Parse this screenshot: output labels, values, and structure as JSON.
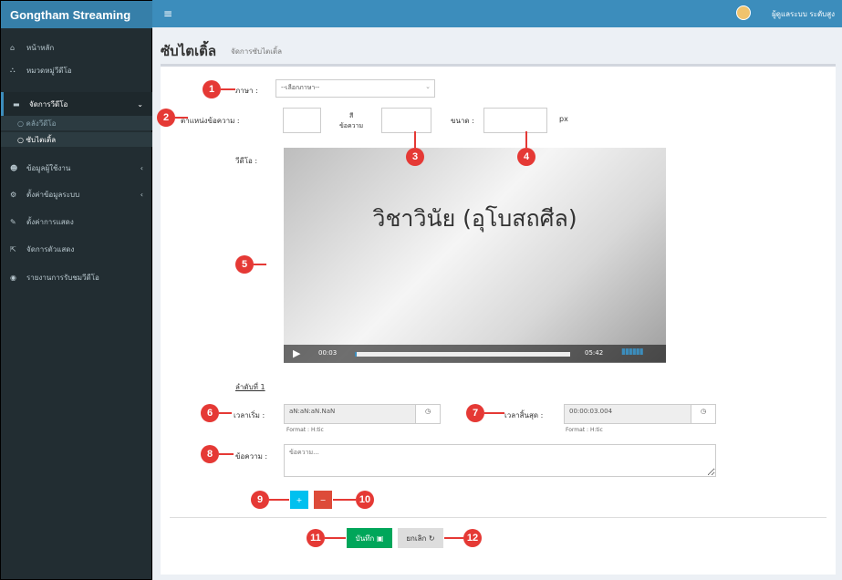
{
  "app": {
    "brand": "Gongtham Streaming",
    "menu_icon": "≡",
    "user": "ผู้ดูแลระบบ ระดับสูง"
  },
  "sidebar": {
    "items": [
      {
        "label": "หน้าหลัก",
        "icon": "home-icon"
      },
      {
        "label": "หมวดหมู่วีดีโอ",
        "icon": "sitemap-icon"
      },
      {
        "label": "จัดการวีดีโอ",
        "icon": "video-icon"
      },
      {
        "label": "ข้อมูลผู้ใช้งาน",
        "icon": "users-icon"
      },
      {
        "label": "ตั้งค่าข้อมูลระบบ",
        "icon": "cogs-icon"
      },
      {
        "label": "ตั้งค่าการแสดง",
        "icon": "edit-icon"
      },
      {
        "label": "จัดการตัวแสดง",
        "icon": "external-icon"
      },
      {
        "label": "รายงานการรับชมวีดีโอ",
        "icon": "report-icon"
      }
    ],
    "subitems": [
      "คลังวีดีโอ",
      "ซับไตเติ้ล"
    ]
  },
  "page": {
    "title": "ซับไตเติ้ล",
    "subtitle": "จัดการซับไตเติ้ล"
  },
  "form": {
    "lang_label": "ภาษา :",
    "lang_value": "--เลือกภาษา--",
    "pos_label": "ตำแหน่งข้อความ :",
    "col_label": "สี\nข้อความ",
    "size_label": "ขนาด :",
    "px": "px",
    "video_label": "วีดีโอ :",
    "video_title": "วิชาวินัย (อุโบสถศีล)",
    "time_cur": "00:03",
    "time_total": "05:42",
    "seq": "ลำดับที่ 1",
    "start_label": "เวลาเริ่ม :",
    "start_value": "aN:aN:aN.NaN",
    "start_fmt": "Format : H:tic",
    "end_label": "เวลาสิ้นสุด :",
    "end_value": "00:00:03.004",
    "end_fmt": "Format : H:tic",
    "text_label": "ข้อความ :",
    "text_placeholder": "ข้อความ...",
    "add_label": "+",
    "del_label": "−",
    "save_label": "บันทึก",
    "cancel_label": "ยกเลิก"
  },
  "colors": {
    "accent": "#3c8dbc",
    "badge": "#e53935",
    "save": "#00a65a",
    "add": "#00c0ef",
    "del": "#dd4b39"
  }
}
